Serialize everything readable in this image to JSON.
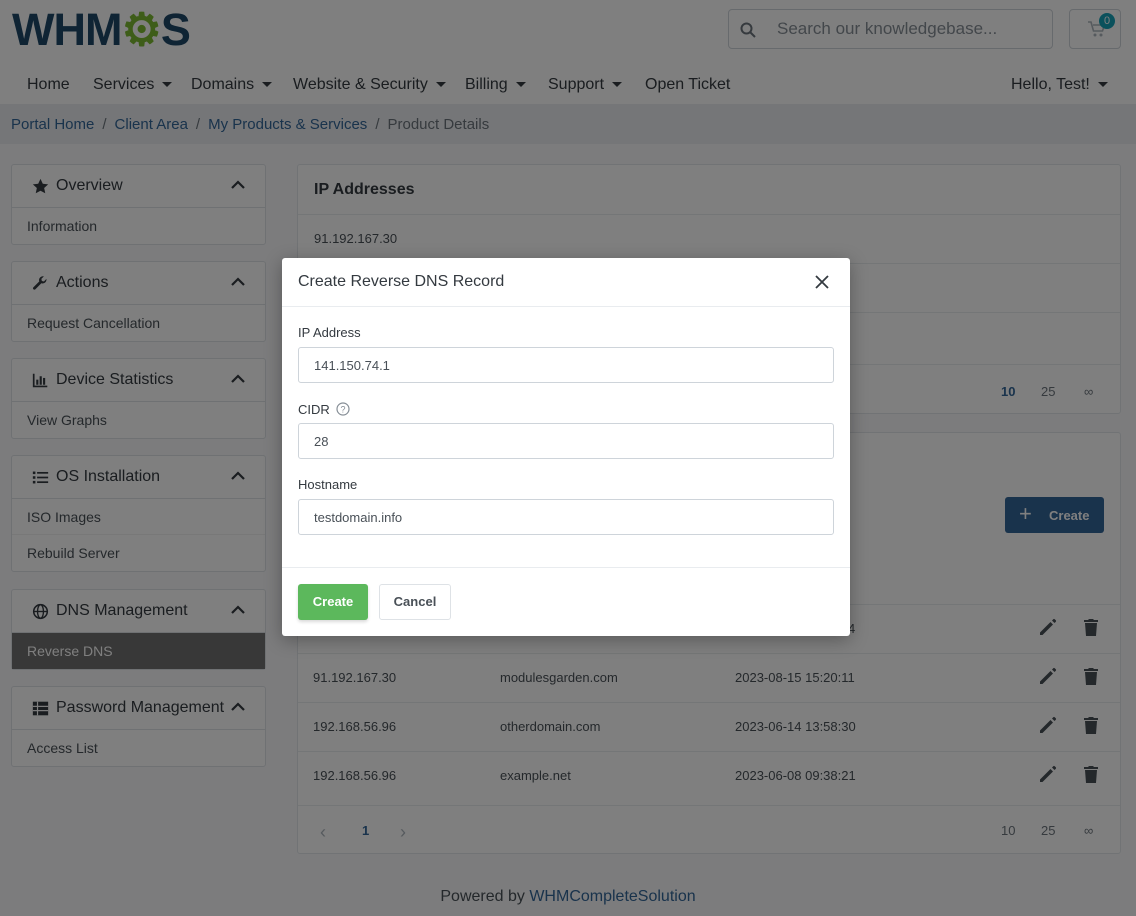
{
  "header": {
    "logo_text": "WHMCS",
    "search": {
      "placeholder": "Search our knowledgebase..."
    },
    "cart": {
      "count": "0"
    }
  },
  "nav": {
    "items": [
      {
        "label": "Home"
      },
      {
        "label": "Services"
      },
      {
        "label": "Domains"
      },
      {
        "label": "Website & Security"
      },
      {
        "label": "Billing"
      },
      {
        "label": "Support"
      },
      {
        "label": "Open Ticket"
      }
    ],
    "user_label": "Hello, Test!"
  },
  "breadcrumb": {
    "items": [
      "Portal Home",
      "Client Area",
      "My Products & Services"
    ],
    "current": "Product Details"
  },
  "sidebar": {
    "panels": [
      {
        "title": "Overview",
        "items": [
          "Information"
        ]
      },
      {
        "title": "Actions",
        "items": [
          "Request Cancellation"
        ]
      },
      {
        "title": "Device Statistics",
        "items": [
          "View Graphs"
        ]
      },
      {
        "title": "OS Installation",
        "items": [
          "ISO Images",
          "Rebuild Server"
        ]
      },
      {
        "title": "DNS Management",
        "items": [
          "Reverse DNS"
        ]
      },
      {
        "title": "Password Management",
        "items": [
          "Access List"
        ]
      }
    ]
  },
  "ip_card": {
    "title": "IP Addresses",
    "rows": [
      "91.192.167.30"
    ],
    "page_sizes": [
      "10",
      "25",
      "∞"
    ]
  },
  "rdns_card": {
    "create_label": "Create",
    "partial_row_date": "4",
    "rows": [
      {
        "ip": "91.192.167.30",
        "hostname": "modulesgarden.com",
        "date": "2023-08-15 15:20:11"
      },
      {
        "ip": "192.168.56.96",
        "hostname": "otherdomain.com",
        "date": "2023-06-14 13:58:30"
      },
      {
        "ip": "192.168.56.96",
        "hostname": "example.net",
        "date": "2023-06-08 09:38:21"
      }
    ],
    "pagination": {
      "prev": "‹",
      "page": "1",
      "next": "›"
    },
    "page_sizes": [
      "10",
      "25",
      "∞"
    ]
  },
  "footer": {
    "prefix": "Powered by",
    "link": "WHMCompleteSolution"
  },
  "modal": {
    "title": "Create Reverse DNS Record",
    "ip_label": "IP Address",
    "ip_value": "141.150.74.1",
    "cidr_label": "CIDR",
    "cidr_value": "28",
    "hostname_label": "Hostname",
    "hostname_value": "testdomain.info",
    "create_label": "Create",
    "cancel_label": "Cancel"
  }
}
